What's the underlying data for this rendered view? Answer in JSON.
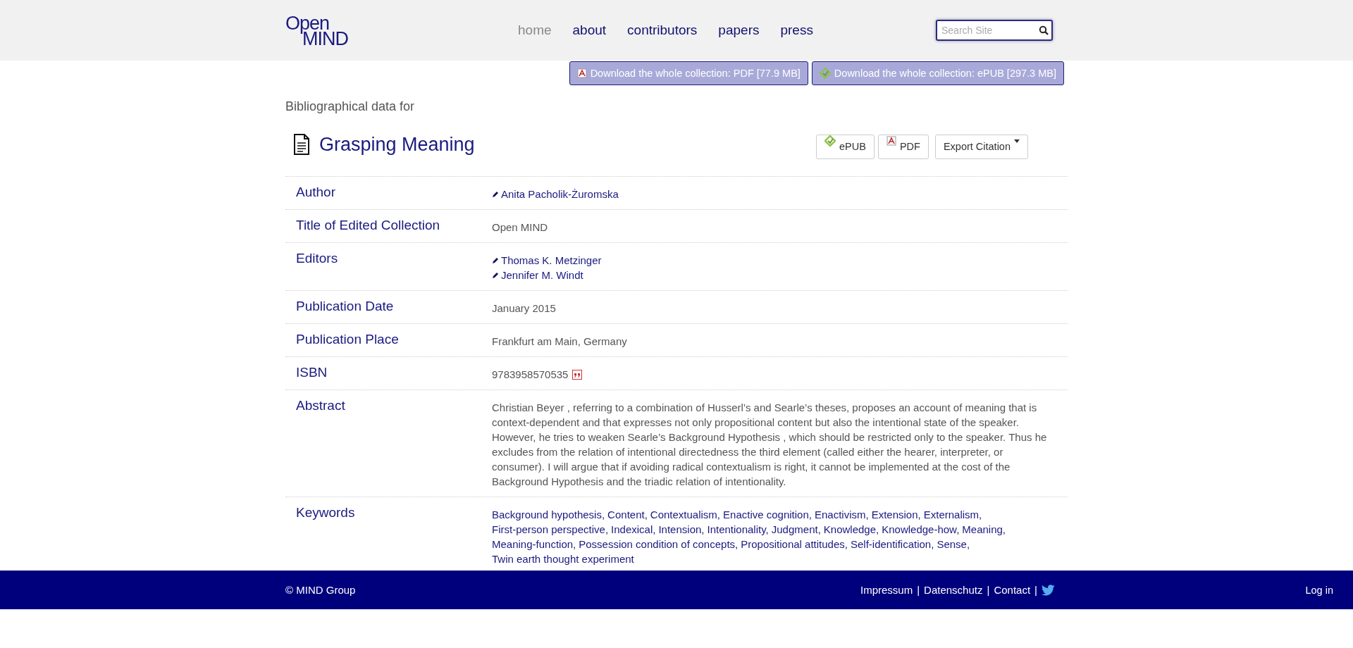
{
  "logo": {
    "line_1": "Open",
    "line_2": "MIND"
  },
  "nav": [
    {
      "label": "home",
      "selected": true
    },
    {
      "label": "about",
      "selected": false
    },
    {
      "label": "contributors",
      "selected": false
    },
    {
      "label": "papers",
      "selected": false
    },
    {
      "label": "press",
      "selected": false
    }
  ],
  "search": {
    "placeholder": "Search Site"
  },
  "downloads": [
    {
      "kind": "pdf",
      "label": "Download the whole collection: PDF [77.9 MB]"
    },
    {
      "kind": "epub",
      "label": "Download the whole collection: ePUB [297.3 MB]"
    }
  ],
  "intro": "Bibliographical data for",
  "title": "Grasping Meaning",
  "actions": [
    {
      "kind": "epub",
      "label": "ePUB"
    },
    {
      "kind": "pdf",
      "label": "PDF"
    },
    {
      "kind": "dropdown",
      "label": "Export Citation"
    }
  ],
  "rows": [
    {
      "label": "Author",
      "kind": "people",
      "values": [
        "Anita Pacholik-Żuromska"
      ]
    },
    {
      "label": "Title of Edited Collection",
      "kind": "text",
      "values": [
        "Open MIND"
      ]
    },
    {
      "label": "Editors",
      "kind": "people",
      "values": [
        "Thomas K. Metzinger",
        "Jennifer M. Windt"
      ]
    },
    {
      "label": "Publication Date",
      "kind": "text",
      "values": [
        "January 2015"
      ]
    },
    {
      "label": "Publication Place",
      "kind": "text",
      "values": [
        "Frankfurt am Main, Germany"
      ]
    },
    {
      "label": "ISBN",
      "kind": "isbn",
      "values": [
        "9783958570535"
      ]
    },
    {
      "label": "Abstract",
      "kind": "text",
      "values": [
        "Christian Beyer , referring to a combination of Husserl’s and Searle’s theses, proposes an account of meaning that is context-dependent and that expresses not only propositional content but also the intentional state of the speaker. However, he tries to weaken Searle’s Background Hypothesis , which should be restricted only to the speaker. Thus he excludes from the relation of intentional directedness the third element (called either the hearer, interpreter, or consumer). I will argue that if avoiding radical contextualism is right, it cannot be implemented at the cost of the Background Hypothesis and the triadic relation of intentionality."
      ]
    },
    {
      "label": "Keywords",
      "kind": "keywords",
      "values": [
        "Background hypothesis,",
        "Content,",
        "Contextualism,",
        "Enactive cognition,",
        "Enactivism,",
        "Extension,",
        "Externalism,",
        "First-person perspective,",
        "Indexical,",
        "Intension,",
        "Intentionality,",
        "Judgment,",
        "Knowledge,",
        "Knowledge-how,",
        "Meaning,",
        "Meaning-function,",
        "Possession condition of concepts,",
        "Propositional attitudes,",
        "Self-identification,",
        "Sense,",
        "Twin earth thought experiment"
      ]
    }
  ],
  "footer": {
    "copyright": "© MIND Group",
    "links": [
      {
        "kind": "link",
        "label": "Impressum"
      },
      {
        "kind": "separator",
        "label": "|"
      },
      {
        "kind": "link",
        "label": "Datenschutz"
      },
      {
        "kind": "separator",
        "label": "|"
      },
      {
        "kind": "link",
        "label": "Contact"
      },
      {
        "kind": "separator",
        "label": "|"
      },
      {
        "kind": "twitter"
      }
    ],
    "login": "Log in"
  }
}
